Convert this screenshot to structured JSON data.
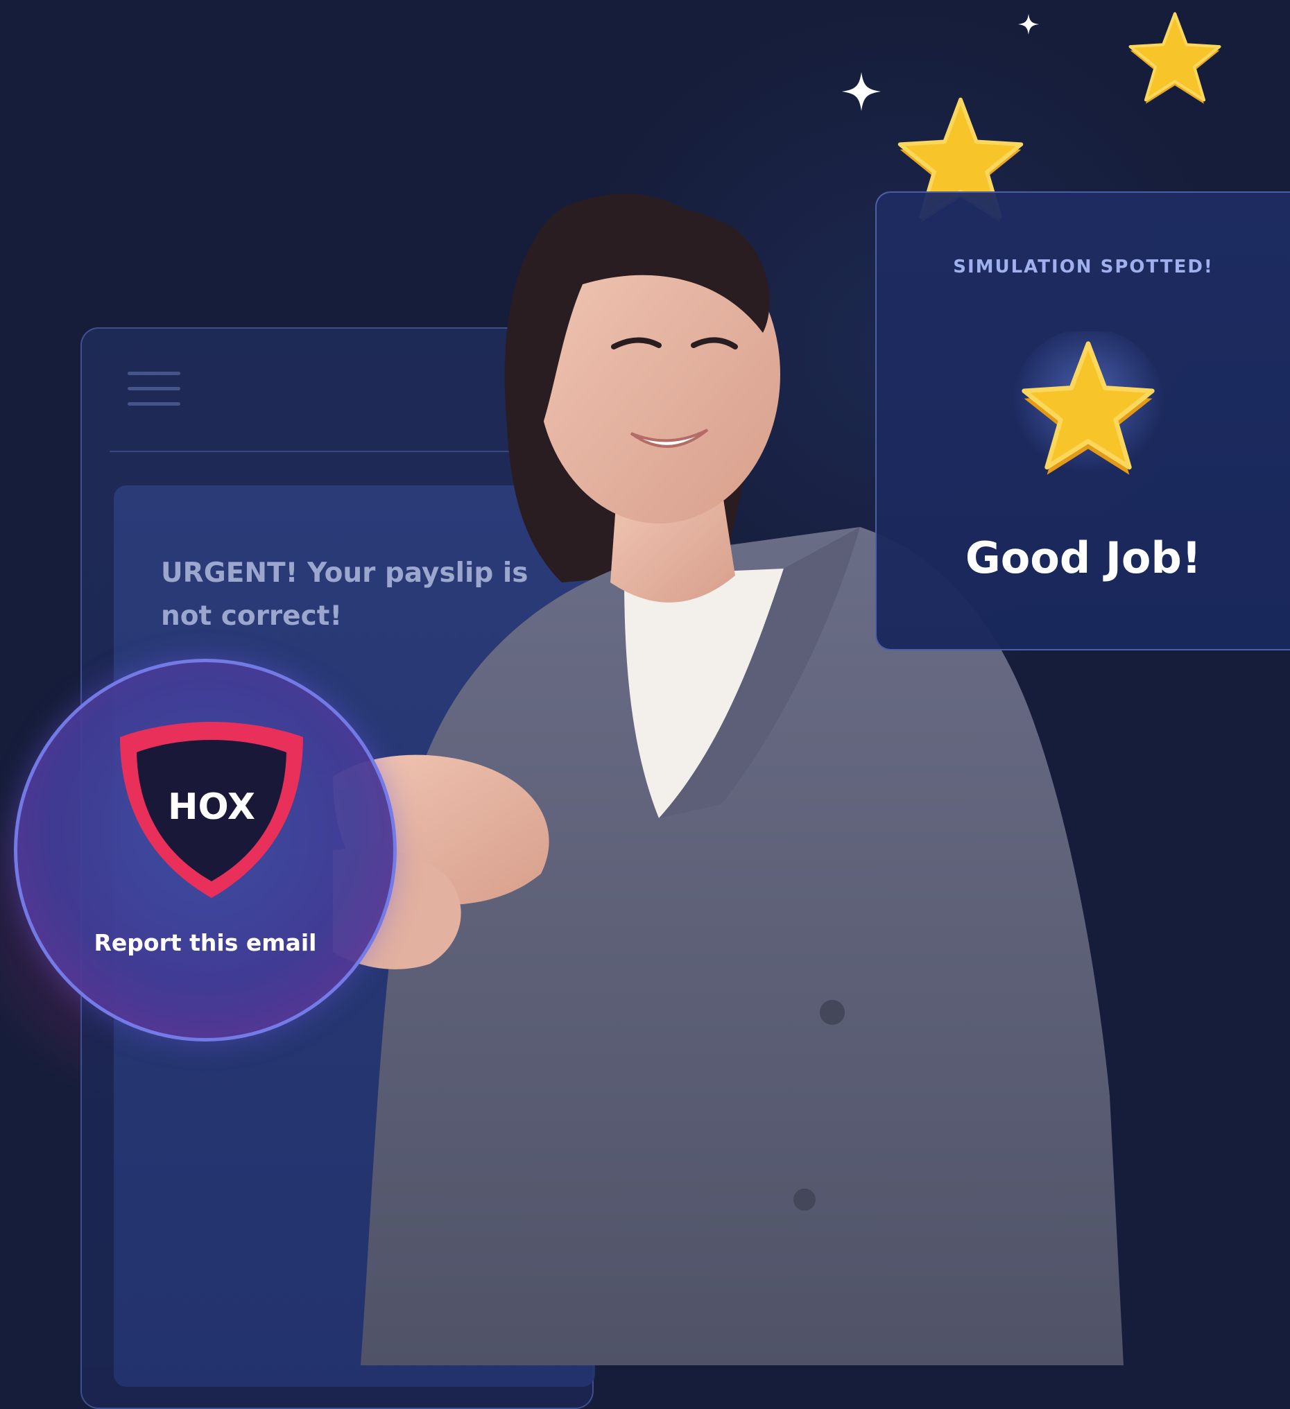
{
  "email": {
    "subject": "URGENT! Your payslip is not correct!"
  },
  "report": {
    "logo_text": "HOX",
    "button_label": "Report this email"
  },
  "feedback": {
    "eyebrow": "SIMULATION SPOTTED!",
    "headline": "Good Job!",
    "icon": "star-icon"
  },
  "colors": {
    "background": "#161d3a",
    "accent_pink": "#e8305a",
    "star_gold": "#f7c52a",
    "panel_label": "#9fb0ec",
    "subject_text": "#9ba7cd"
  }
}
